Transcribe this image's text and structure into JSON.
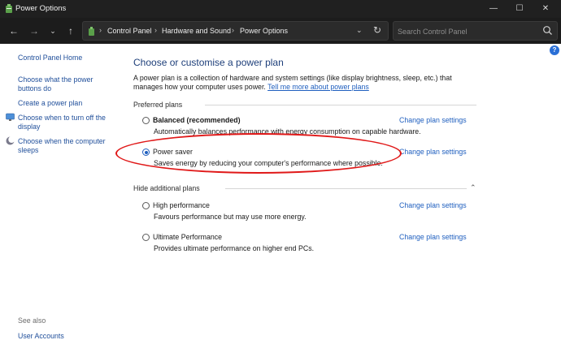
{
  "window": {
    "title": "Power Options",
    "minimize_glyph": "—",
    "maximize_glyph": "☐",
    "close_glyph": "✕"
  },
  "nav": {
    "back_glyph": "←",
    "forward_glyph": "→",
    "recent_glyph": "⌄",
    "up_glyph": "↑",
    "breadcrumb": [
      "Control Panel",
      "Hardware and Sound",
      "Power Options"
    ],
    "breadcrumb_sep": "›",
    "dropdown_glyph": "⌄",
    "refresh_glyph": "↻"
  },
  "search": {
    "placeholder": "Search Control Panel",
    "value": ""
  },
  "sidebar": {
    "home": "Control Panel Home",
    "item_power_buttons_1": "Choose what the power",
    "item_power_buttons_2": "buttons do",
    "item_create_plan": "Create a power plan",
    "item_display_off_1": "Choose when to turn off the",
    "item_display_off_2": "display",
    "item_sleep_1": "Choose when the computer",
    "item_sleep_2": "sleeps",
    "see_also": "See also",
    "user_accounts": "User Accounts"
  },
  "help_glyph": "?",
  "main": {
    "title": "Choose or customise a power plan",
    "desc_line1": "A power plan is a collection of hardware and system settings (like display brightness, sleep, etc.) that",
    "desc_line2_prefix": "manages how your computer uses power. ",
    "desc_link": "Tell me more about power plans",
    "preferred_label": "Preferred plans",
    "additional_label": "Hide additional plans",
    "collapse_glyph": "⌃",
    "change_settings": "Change plan settings",
    "plans": [
      {
        "name": "Balanced (recommended)",
        "desc": "Automatically balances performance with energy consumption on capable hardware.",
        "selected": false
      },
      {
        "name": "Power saver",
        "desc": "Saves energy by reducing your computer's performance where possible.",
        "selected": true
      },
      {
        "name": "High performance",
        "desc": "Favours performance but may use more energy.",
        "selected": false
      },
      {
        "name": "Ultimate Performance",
        "desc": "Provides ultimate performance on higher end PCs.",
        "selected": false
      }
    ]
  },
  "colors": {
    "link": "#1f5fbf",
    "title_blue": "#1e3f7a",
    "annotation_red": "#e01818",
    "titlebar_bg": "#202020"
  }
}
